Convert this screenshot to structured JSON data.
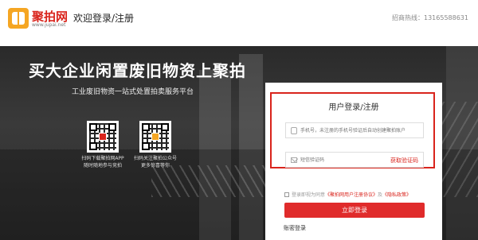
{
  "header": {
    "logo_text": "聚拍网",
    "logo_sub": "www.jupai.net",
    "title": "欢迎登录/注册",
    "hotline_label": "招商热线：",
    "hotline_number": "13165588631"
  },
  "hero": {
    "slogan": "买大企业闲置废旧物资上聚拍",
    "sub_slogan": "工业废旧物资一站式处置拍卖服务平台",
    "qr_codes": [
      {
        "caption_line1": "扫码下载聚拍网APP",
        "caption_line2": "随时随地参与竞拍"
      },
      {
        "caption_line1": "扫码关注聚拍公众号",
        "caption_line2": "更多惊喜等你"
      }
    ]
  },
  "login": {
    "title": "用户登录/注册",
    "phone_placeholder": "手机号，未注册的手机号验证后自动创建聚拍账户",
    "code_placeholder": "短信验证码",
    "get_code_label": "获取验证码",
    "agree_prefix": "登录即视为同意",
    "agree_link1": "《聚拍网用户注册协议》",
    "agree_and": "及",
    "agree_link2": "《隐私政策》",
    "login_button": "立即登录",
    "account_link": "账密登录"
  },
  "colors": {
    "brand_red": "#d9241c",
    "logo_orange": "#f5a623",
    "button_red": "#e02b2b"
  }
}
